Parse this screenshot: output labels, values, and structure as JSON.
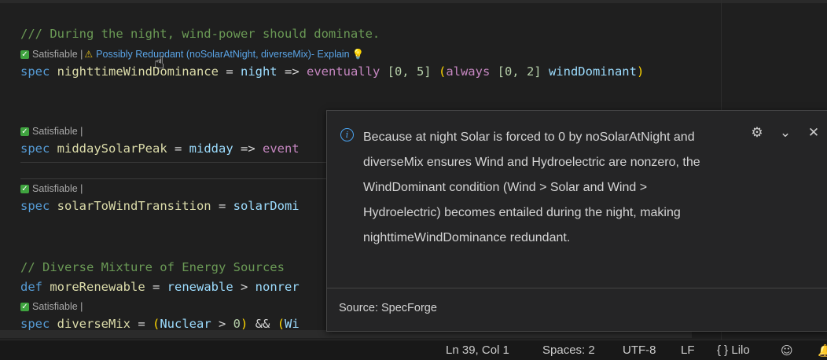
{
  "editor": {
    "comment1": "/// During the night, wind-power should dominate.",
    "lens1": {
      "satisfiable": "Satisfiable |",
      "redundant_link": "Possibly Redundant (noSolarAtNight, diverseMix)- Explain"
    },
    "line1": {
      "kw": "spec",
      "name": "nighttimeWindDominance",
      "eq": " = ",
      "a": "night",
      "arrow": " => ",
      "eventually": "eventually",
      "range1": " [0, 5] ",
      "paren_open": "(",
      "always": "always",
      "range2": " [0, 2] ",
      "b": "windDominant",
      "paren_close": ")"
    },
    "lens2": {
      "satisfiable": "Satisfiable |"
    },
    "line2": {
      "kw": "spec",
      "name": "middaySolarPeak",
      "eq": " = ",
      "a": "midday",
      "arrow": " => ",
      "rest": "event"
    },
    "lens3": {
      "satisfiable": "Satisfiable |"
    },
    "line3": {
      "kw": "spec",
      "name": "solarToWindTransition",
      "eq": " = ",
      "rest": "solarDomi"
    },
    "comment2": "// Diverse Mixture of Energy Sources",
    "line4": {
      "kw": "def",
      "name": "moreRenewable",
      "eq": " = ",
      "a": "renewable",
      "op": " > ",
      "rest": "nonrer"
    },
    "lens4": {
      "satisfiable": "Satisfiable |"
    },
    "line5": {
      "kw": "spec",
      "name": "diverseMix",
      "eq": " = ",
      "paren_open": "(",
      "a": "Nuclear",
      "op": " > ",
      "num": "0",
      "paren_close": ")",
      "and": " && ",
      "paren2": "(",
      "rest": "Wi"
    }
  },
  "hover": {
    "message": "Because at night Solar is forced to 0 by noSolarAtNight and diverseMix ensures Wind and Hydroelectric are nonzero, the WindDominant condition (Wind > Solar and Wind > Hydroelectric) becomes entailed during the night, making nighttimeWindDominance redundant.",
    "source": "Source: SpecForge"
  },
  "status": {
    "position": "Ln 39, Col 1",
    "spaces": "Spaces: 2",
    "encoding": "UTF-8",
    "eol": "LF",
    "language": "Lilo"
  }
}
